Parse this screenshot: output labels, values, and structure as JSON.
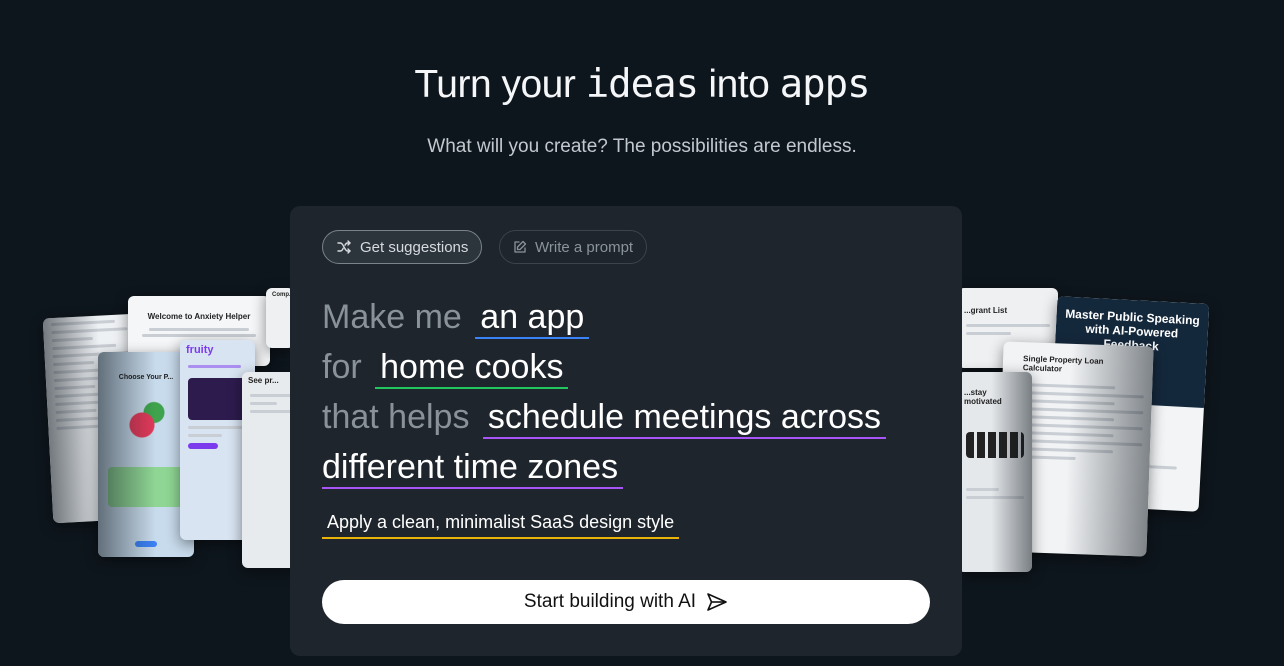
{
  "hero": {
    "title_part1": "Turn your ",
    "title_pixel": "ideas",
    "title_part2": " into ",
    "title_pixel2": "apps",
    "subtitle": "What will you create? The possibilities are endless."
  },
  "panel": {
    "tabs": [
      {
        "label": "Get suggestions",
        "icon": "shuffle-icon",
        "active": true
      },
      {
        "label": "Write a prompt",
        "icon": "edit-icon",
        "active": false
      }
    ],
    "prompt": {
      "lead1": "Make me",
      "fill1": "an app",
      "lead2": "for",
      "fill2": "home cooks",
      "lead3": "that helps",
      "fill3a": "schedule meetings across",
      "fill3b": "different time zones"
    },
    "style": "Apply a clean, minimalist SaaS design style",
    "cta_label": "Start building with AI",
    "cta_icon": "send-icon"
  },
  "preview_cards": {
    "left": [
      {
        "title": "Welcome to Anxiety Helper"
      },
      {
        "title": "Choose Your P..."
      },
      {
        "title": "fruity"
      },
      {
        "title": "See pr..."
      },
      {
        "title": "Comp..."
      }
    ],
    "right": [
      {
        "title": "...grant List"
      },
      {
        "title": "Master Public Speaking with AI-Powered Feedback"
      },
      {
        "title": "Single Property Loan Calculator"
      },
      {
        "title": "...stay motivated"
      }
    ]
  },
  "colors": {
    "background": "#0e161d",
    "panel": "#1e252c",
    "underline_blue": "#3b82f6",
    "underline_green": "#22c55e",
    "underline_purple": "#a855f7",
    "underline_yellow": "#eab308",
    "accent_teal": "#2dd4bf"
  }
}
